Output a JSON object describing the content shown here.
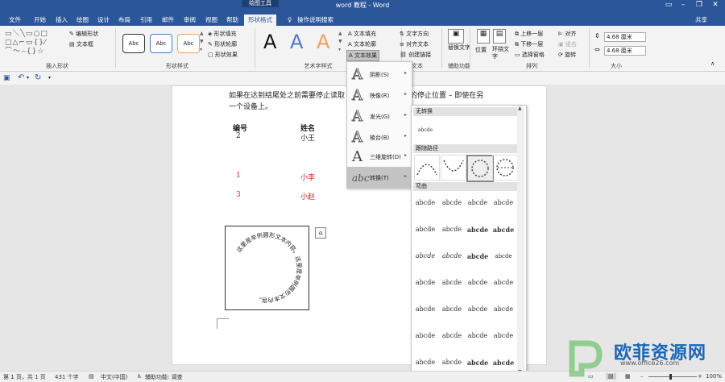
{
  "window": {
    "title": "word 教程 - Word",
    "context_tab_group": "绘图工具",
    "share": "共享"
  },
  "tabs": [
    "文件",
    "开始",
    "插入",
    "绘图",
    "设计",
    "布局",
    "引用",
    "邮件",
    "审阅",
    "视图",
    "帮助",
    "形状格式"
  ],
  "search_hint": "操作说明搜索",
  "ribbon": {
    "insert_shapes": {
      "label": "插入形状",
      "edit_shape": "编辑形状",
      "text_box": "文本框"
    },
    "shape_styles": {
      "label": "形状样式",
      "preview": "Abc",
      "fill": "形状填充",
      "outline": "形状轮廓",
      "effects": "形状效果"
    },
    "wordart": {
      "label": "艺术字样式",
      "letter": "A",
      "text_fill": "文本填充",
      "text_outline": "文本轮廓",
      "text_effects": "文本效果"
    },
    "text": {
      "label": "文本",
      "direction": "文字方向",
      "align": "对齐文本",
      "link": "创建链接"
    },
    "accessibility": {
      "label": "辅助功能",
      "alt_text": "替换文字"
    },
    "arrange": {
      "label": "排列",
      "position": "位置",
      "wrap": "环绕文字",
      "forward": "上移一层",
      "backward": "下移一层",
      "pane": "选择窗格",
      "align": "对齐",
      "group": "组合",
      "rotate": "旋转"
    },
    "size": {
      "label": "大小",
      "height": "4.68 厘米",
      "width": "4.68 厘米"
    }
  },
  "document": {
    "paragraph_line1": "如果在达到结尾处之前需要停止读取",
    "paragraph_line1_end": "的停止位置 – 即使在另",
    "paragraph_line2": "一个设备上。",
    "table_header": {
      "no": "编号",
      "name": "姓名"
    },
    "rows": [
      {
        "no": "2",
        "name": "小王"
      },
      {
        "no": "1",
        "name": "小李"
      },
      {
        "no": "3",
        "name": "小赵"
      }
    ],
    "circle_text": "这里是举例圆形文本内容。这里是举例圆形文本内容。"
  },
  "text_effects_menu": [
    {
      "label": "阴影(S)"
    },
    {
      "label": "映像(R)"
    },
    {
      "label": "发光(G)"
    },
    {
      "label": "棱台(B)"
    },
    {
      "label": "三维旋转(D)"
    },
    {
      "label": "转换(T)"
    }
  ],
  "transform_panel": {
    "no_transform_title": "无转换",
    "no_transform_sample": "abcde",
    "follow_path_title": "跟随路径",
    "warp_title": "弯曲",
    "sample": "abcde",
    "more": "....."
  },
  "statusbar": {
    "page": "第 1 页，共 1 页",
    "words": "431 个字",
    "language": "中文(中国)",
    "accessibility": "辅助功能: 调查",
    "zoom": "100%"
  },
  "watermark": {
    "text": "欧菲资源网",
    "url": "www.office26.com"
  },
  "colors": {
    "ribbon_blue": "#2b579a",
    "red_text": "#e02020",
    "wordart_blue": "#4a7bc8",
    "wordart_orange": "#f0a060"
  }
}
